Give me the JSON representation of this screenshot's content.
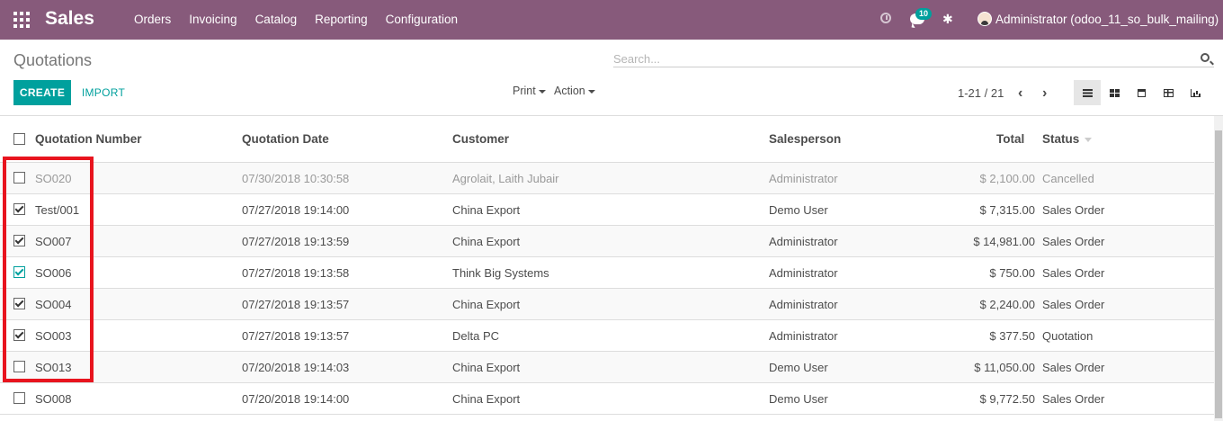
{
  "topbar": {
    "app_name": "Sales",
    "menu": [
      "Orders",
      "Invoicing",
      "Catalog",
      "Reporting",
      "Configuration"
    ],
    "chat_count": "10",
    "user": "Administrator (odoo_11_so_bulk_mailing)",
    "color": "#875a7b"
  },
  "control": {
    "breadcrumb": "Quotations",
    "search_placeholder": "Search...",
    "create_label": "CREATE",
    "import_label": "IMPORT",
    "print_label": "Print",
    "action_label": "Action",
    "pager": "1-21 / 21",
    "accent": "#00a09d"
  },
  "table": {
    "headers": {
      "number": "Quotation Number",
      "date": "Quotation Date",
      "customer": "Customer",
      "salesperson": "Salesperson",
      "total": "Total",
      "status": "Status"
    },
    "rows": [
      {
        "number": "SO020",
        "date": "07/30/2018 10:30:58",
        "customer": "Agrolait, Laith Jubair",
        "salesperson": "Administrator",
        "total": "$ 2,100.00",
        "status": "Cancelled",
        "checked": false
      },
      {
        "number": "Test/001",
        "date": "07/27/2018 19:14:00",
        "customer": "China Export",
        "salesperson": "Demo User",
        "total": "$ 7,315.00",
        "status": "Sales Order",
        "checked": true
      },
      {
        "number": "SO007",
        "date": "07/27/2018 19:13:59",
        "customer": "China Export",
        "salesperson": "Administrator",
        "total": "$ 14,981.00",
        "status": "Sales Order",
        "checked": true
      },
      {
        "number": "SO006",
        "date": "07/27/2018 19:13:58",
        "customer": "Think Big Systems",
        "salesperson": "Administrator",
        "total": "$ 750.00",
        "status": "Sales Order",
        "checked": true
      },
      {
        "number": "SO004",
        "date": "07/27/2018 19:13:57",
        "customer": "China Export",
        "salesperson": "Administrator",
        "total": "$ 2,240.00",
        "status": "Sales Order",
        "checked": true
      },
      {
        "number": "SO003",
        "date": "07/27/2018 19:13:57",
        "customer": "Delta PC",
        "salesperson": "Administrator",
        "total": "$ 377.50",
        "status": "Quotation",
        "checked": true
      },
      {
        "number": "SO013",
        "date": "07/20/2018 19:14:03",
        "customer": "China Export",
        "salesperson": "Demo User",
        "total": "$ 11,050.00",
        "status": "Sales Order",
        "checked": false
      },
      {
        "number": "SO008",
        "date": "07/20/2018 19:14:00",
        "customer": "China Export",
        "salesperson": "Demo User",
        "total": "$ 9,772.50",
        "status": "Sales Order",
        "checked": false
      }
    ]
  }
}
